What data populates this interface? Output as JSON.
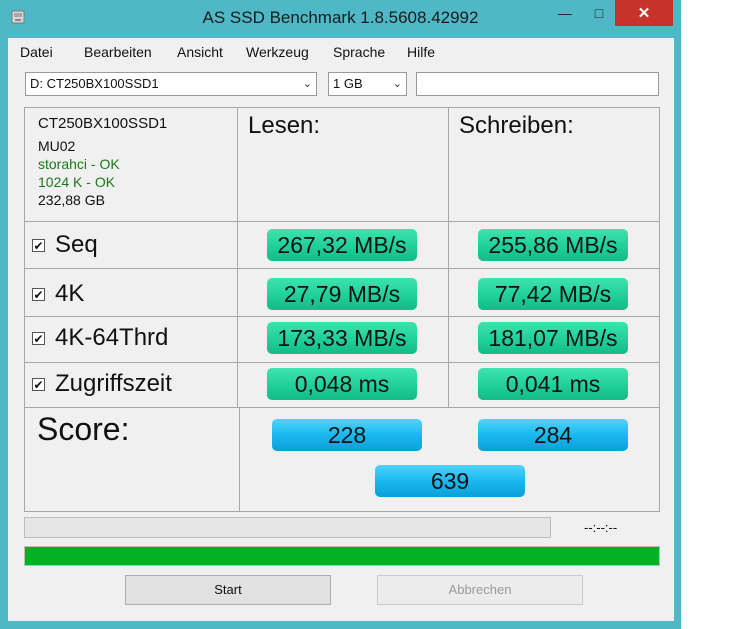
{
  "window": {
    "title": "AS SSD Benchmark 1.8.5608.42992",
    "minimize_glyph": "—",
    "maximize_glyph": "□",
    "close_glyph": "✕"
  },
  "menu": [
    "Datei",
    "Bearbeiten",
    "Ansicht",
    "Werkzeug",
    "Sprache",
    "Hilfe"
  ],
  "toolbar": {
    "drive_select": "D: CT250BX100SSD1",
    "size_select": "1 GB",
    "dropdown_glyph": "⌄",
    "text_field_value": ""
  },
  "drive_info": {
    "model": "CT250BX100SSD1",
    "firmware": "MU02",
    "driver": "storahci - OK",
    "alignment": "1024 K - OK",
    "capacity": "232,88 GB"
  },
  "headers": {
    "read": "Lesen:",
    "write": "Schreiben:"
  },
  "tests": [
    {
      "label": "Seq",
      "checked": true,
      "read": "267,32 MB/s",
      "write": "255,86 MB/s"
    },
    {
      "label": "4K",
      "checked": true,
      "read": "27,79 MB/s",
      "write": "77,42 MB/s"
    },
    {
      "label": "4K-64Thrd",
      "checked": true,
      "read": "173,33 MB/s",
      "write": "181,07 MB/s"
    },
    {
      "label": "Zugriffszeit",
      "checked": true,
      "read": "0,048 ms",
      "write": "0,041 ms"
    }
  ],
  "check_glyph": "✔",
  "score": {
    "label": "Score:",
    "read": "228",
    "write": "284",
    "total": "639"
  },
  "progress": {
    "time_text": "--:--:--",
    "upper_fraction": 0.0,
    "lower_fraction": 1.0
  },
  "buttons": {
    "start": "Start",
    "cancel": "Abbrechen"
  },
  "colors": {
    "window_frame": "#4fb8c6",
    "close_button": "#c7322b",
    "result_pill": "#22d29a",
    "score_pill": "#1ab8ee",
    "progress_fill": "#06b025",
    "driver_ok": "#1a7a1a"
  },
  "icons": {
    "app": "drive-icon"
  }
}
